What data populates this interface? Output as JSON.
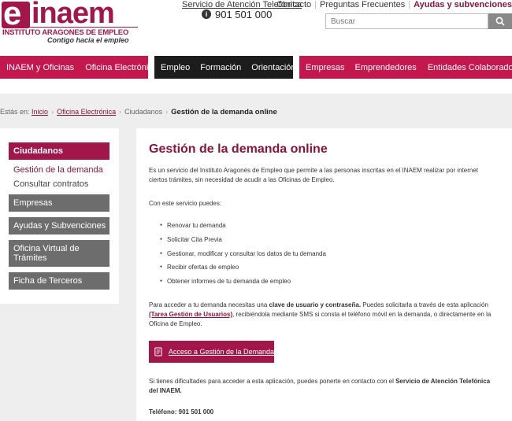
{
  "header": {
    "logo_letter": "e",
    "logo_name": "inaem",
    "logo_subtitle": "INSTITUTO ARAGONES DE EMPLEO",
    "logo_tagline": "Contigo hacia el empleo",
    "phone_label": "Servicio de Atención Telefónica",
    "phone_number": "901 501 000",
    "toplinks": [
      "Contacto",
      "Preguntas Frecuentes",
      "Ayudas y subvenciones"
    ],
    "search_placeholder": "Buscar"
  },
  "nav": {
    "group1": [
      "INAEM y Oficinas",
      "Oficina Electrónica"
    ],
    "group2": [
      "Empleo",
      "Formación",
      "Orientación"
    ],
    "group3": [
      "Empresas",
      "Emprendedores",
      "Entidades Colaboradoras"
    ]
  },
  "breadcrumb": {
    "prefix": "Estás en:",
    "items": [
      "Inicio",
      "Oficina Electrónica",
      "Ciudadanos"
    ],
    "current": "Gestión de la demanda online"
  },
  "sidebar": {
    "active": "Ciudadanos",
    "sub": [
      "Gestión de la demanda",
      "Consultar contratos"
    ],
    "items": [
      "Empresas",
      "Ayudas y Subvenciones",
      "Oficina Virtual de Trámites",
      "Ficha de Terceros"
    ]
  },
  "content": {
    "title": "Gestión de la demanda online",
    "intro": "Es un servicio del Instituto Aragonés de Empleo que permite a las personas inscritas en el INAEM realizar por internet ciertos trámites, sin necesidad de acudir a las Oficinas de Empleo.",
    "services_heading": "Con este servicio puedes:",
    "services": [
      "Renovar tu demanda",
      "Solicitar Cita Previa",
      "Gestionar, modificar y consultar los datos de tu demanda",
      "Recibir ofertas de empleo",
      "Obtener informes de tu demanda de empleo"
    ],
    "access_p1": "Para acceder a tu demanda necesitas una ",
    "access_b1": "clave de usuario y contraseña.",
    "access_p2": " Puedes solicitarla a través de esta aplicación ",
    "access_link": "(Tarea Gestión de Usuarios)",
    "access_p3": ", recibiéndola mediante SMS si consta el teléfono móvil en la demanda, o directamente en la Oficina de Empleo.",
    "access_button": "Acceso a Gestión de la Demanda",
    "help_p1": "Si tienes dificultades para acceder a esta aplicación, puedes ponerte en contacto con el ",
    "help_b1": "Servicio de Atención Telefónica del INAEM.",
    "phone_line": "Teléfono: 901 501 000"
  },
  "colors": {
    "brand": "#a3164a",
    "nav_red": "#c3174e",
    "nav_dark": "#1c1c1c",
    "sidebar_gray": "#6d6d6d",
    "background_gray": "#eeeeee"
  }
}
